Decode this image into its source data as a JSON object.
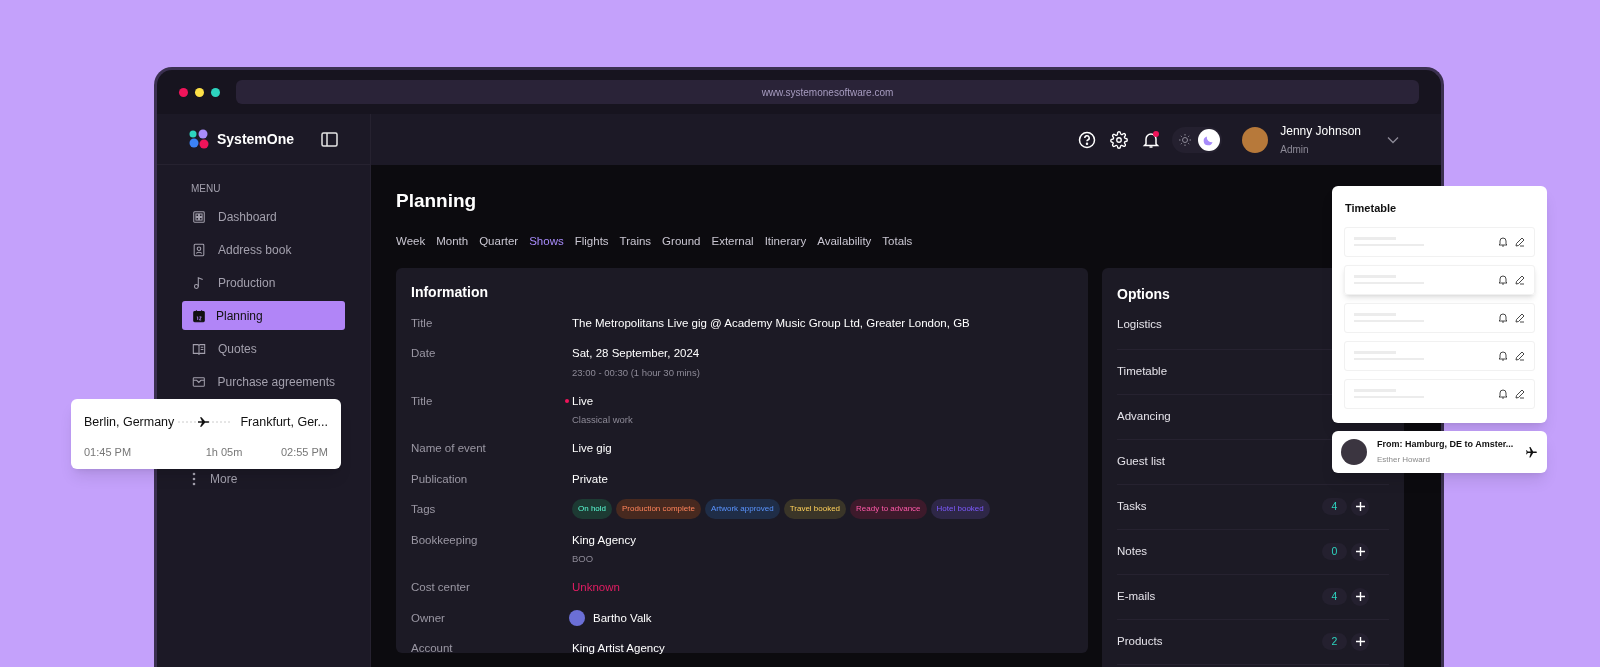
{
  "browser": {
    "url": "www.systemonesoftware.com"
  },
  "sidebar": {
    "brand": "SystemOne",
    "menu_heading": "MENU",
    "items": [
      {
        "label": "Dashboard",
        "selected": false
      },
      {
        "label": "Address book",
        "selected": false
      },
      {
        "label": "Production",
        "selected": false
      },
      {
        "label": "Planning",
        "selected": true
      },
      {
        "label": "Quotes",
        "selected": false
      },
      {
        "label": "Purchase agreements",
        "selected": false
      }
    ],
    "more": {
      "label": "More"
    }
  },
  "header": {
    "has_unread_notifications": true,
    "dark_mode": true,
    "user": {
      "name": "Jenny Johnson",
      "role": "Admin"
    }
  },
  "page": {
    "title": "Planning",
    "tabs": [
      {
        "label": "Week",
        "selected": false
      },
      {
        "label": "Month",
        "selected": false
      },
      {
        "label": "Quarter",
        "selected": false
      },
      {
        "label": "Shows",
        "selected": true
      },
      {
        "label": "Flights",
        "selected": false
      },
      {
        "label": "Trains",
        "selected": false
      },
      {
        "label": "Ground",
        "selected": false
      },
      {
        "label": "External",
        "selected": false
      },
      {
        "label": "Itinerary",
        "selected": false
      },
      {
        "label": "Availability",
        "selected": false
      },
      {
        "label": "Totals",
        "selected": false
      }
    ]
  },
  "information": {
    "title": "Information",
    "rows": [
      {
        "kind": "text",
        "label": "Title",
        "value": "The Metropolitans Live gig @ Academy Music Group Ltd, Greater London, GB"
      },
      {
        "kind": "text",
        "label": "Date",
        "value": "Sat, 28 September, 2024",
        "subtext": "23:00 - 00:30 (1 hour 30 mins)"
      },
      {
        "kind": "status",
        "label": "Title",
        "value": "Live",
        "subtext": "Classical work",
        "color": "#f0145a"
      },
      {
        "kind": "text",
        "label": "Name of event",
        "value": "Live gig"
      },
      {
        "kind": "text",
        "label": "Publication",
        "value": "Private"
      },
      {
        "kind": "tags",
        "label": "Tags",
        "tags": [
          {
            "label": "On hold",
            "color": "#1d3a33"
          },
          {
            "label": "Production complete",
            "color": "#47291f"
          },
          {
            "label": "Artwork approved",
            "color": "#1f2d47"
          },
          {
            "label": "Travel booked",
            "color": "#3a3528"
          },
          {
            "label": "Ready to advance",
            "color": "#3d1a2b"
          },
          {
            "label": "Hotel booked",
            "color": "#2e2747"
          }
        ]
      },
      {
        "kind": "text",
        "label": "Bookkeeping",
        "value": "King Agency",
        "subtext": "BOO"
      },
      {
        "kind": "alert",
        "label": "Cost center",
        "value": "Unknown"
      },
      {
        "kind": "person",
        "label": "Owner",
        "value": "Bartho Valk"
      },
      {
        "kind": "text",
        "label": "Account",
        "value": "King Artist Agency"
      }
    ]
  },
  "options": {
    "title": "Options",
    "items": [
      {
        "label": "Logistics"
      },
      {
        "label": "Timetable"
      },
      {
        "label": "Advancing"
      },
      {
        "label": "Guest list"
      },
      {
        "label": "Tasks",
        "count": "4"
      },
      {
        "label": "Notes",
        "count": "0"
      },
      {
        "label": "E-mails",
        "count": "4"
      },
      {
        "label": "Products",
        "count": "2"
      }
    ]
  },
  "timetable_popup": {
    "title": "Timetable"
  },
  "notification": {
    "title": "From: Hamburg, DE to Amster...",
    "subtitle": "Esther Howard"
  },
  "flight_card": {
    "from": "Berlin, Germany",
    "to": "Frankfurt, Ger...",
    "departure": "01:45 PM",
    "duration": "1h 05m",
    "arrival": "02:55 PM"
  }
}
